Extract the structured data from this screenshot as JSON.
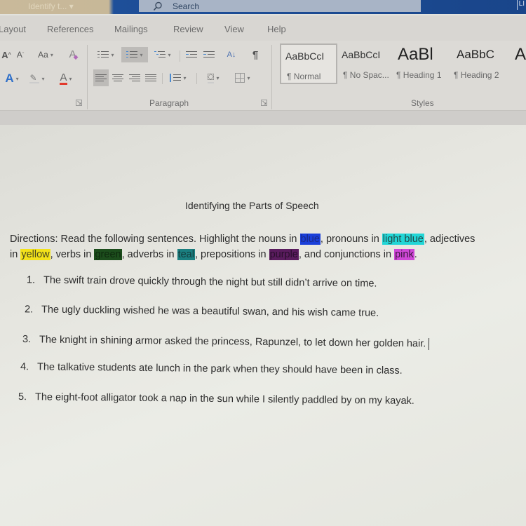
{
  "titlebar": {
    "doc_title": "Identify t... ▾",
    "search_label": "Search",
    "user_initials": "LI"
  },
  "ribbon_tabs": [
    "Layout",
    "References",
    "Mailings",
    "Review",
    "View",
    "Help"
  ],
  "ribbon": {
    "font_group": {
      "grow_font": "A",
      "shrink_font": "A",
      "change_case": "Aa",
      "clear_formatting": "A",
      "text_effects": "A",
      "font_color": "A"
    },
    "paragraph_group": {
      "label": "Paragraph",
      "sort": "A↓",
      "show_marks": "¶"
    },
    "styles_group": {
      "label": "Styles",
      "items": [
        {
          "preview": "AaBbCcI",
          "name": "¶ Normal",
          "selected": true
        },
        {
          "preview": "AaBbCcI",
          "name": "¶ No Spac...",
          "selected": false
        },
        {
          "preview": "AaBl",
          "name": "¶ Heading 1",
          "selected": false
        },
        {
          "preview": "AaBbC",
          "name": "¶ Heading 2",
          "selected": false
        },
        {
          "preview": "A",
          "name": "",
          "selected": false
        }
      ]
    }
  },
  "document": {
    "heading": "Identifying the Parts of Speech",
    "directions": {
      "p1": "Directions: Read the following sentences. Highlight the nouns in ",
      "blue": "blue",
      "p2": ", pronouns in ",
      "light_blue": "light blue",
      "p3": ", adjectives",
      "p4": "in ",
      "yellow": "yellow",
      "p5": ", verbs in ",
      "green": "green",
      "p6": ", adverbs in ",
      "teal": "teal",
      "p7": ", prepositions in ",
      "purple": "purple",
      "p8": ", and conjunctions in ",
      "pink": "pink",
      "p9": "."
    },
    "highlight_colors": {
      "blue": "#1a3fd9",
      "light_blue": "#22d6d6",
      "yellow": "#f3e21a",
      "green": "#1c4d1c",
      "teal": "#1a7f80",
      "purple": "#5a1c5e",
      "pink": "#cf48d7"
    },
    "sentences": [
      {
        "num": "1.",
        "text": "The swift train drove quickly through the night but still didn’t arrive on time."
      },
      {
        "num": "2.",
        "text": "The ugly duckling wished he was a beautiful swan, and his wish came true."
      },
      {
        "num": "3.",
        "text": "The knight in shining armor asked the princess, Rapunzel, to let down her golden hair."
      },
      {
        "num": "4.",
        "text": "The talkative students ate lunch in the park when they should have been in class."
      },
      {
        "num": "5.",
        "text": "The eight-foot alligator took a nap in the sun while I silently paddled by on my kayak."
      }
    ]
  }
}
